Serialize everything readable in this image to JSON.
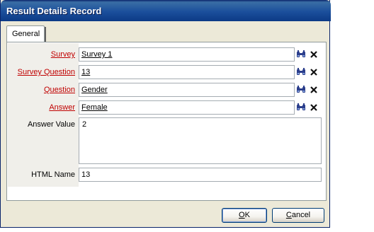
{
  "window": {
    "title": "Result Details Record"
  },
  "tabs": [
    {
      "label": "General",
      "selected": true
    }
  ],
  "fields": {
    "survey": {
      "label": "Survey",
      "value": "Survey 1"
    },
    "survey_question": {
      "label": "Survey Question",
      "value": "13"
    },
    "question": {
      "label": "Question",
      "value": "Gender"
    },
    "answer": {
      "label": "Answer",
      "value": "Female"
    },
    "answer_value": {
      "label": "Answer Value",
      "value": "2"
    },
    "html_name": {
      "label": "HTML Name",
      "value": "13"
    }
  },
  "icons": {
    "lookup": "binoculars-icon",
    "clear": "clear-x-icon"
  },
  "buttons": {
    "ok": {
      "label_accel": "O",
      "label_rest": "K"
    },
    "cancel": {
      "label_accel": "C",
      "label_rest": "ancel"
    }
  },
  "colors": {
    "required_label": "#c00000",
    "titlebar": "#0c3a86",
    "dialog_bg": "#ece9d8"
  }
}
